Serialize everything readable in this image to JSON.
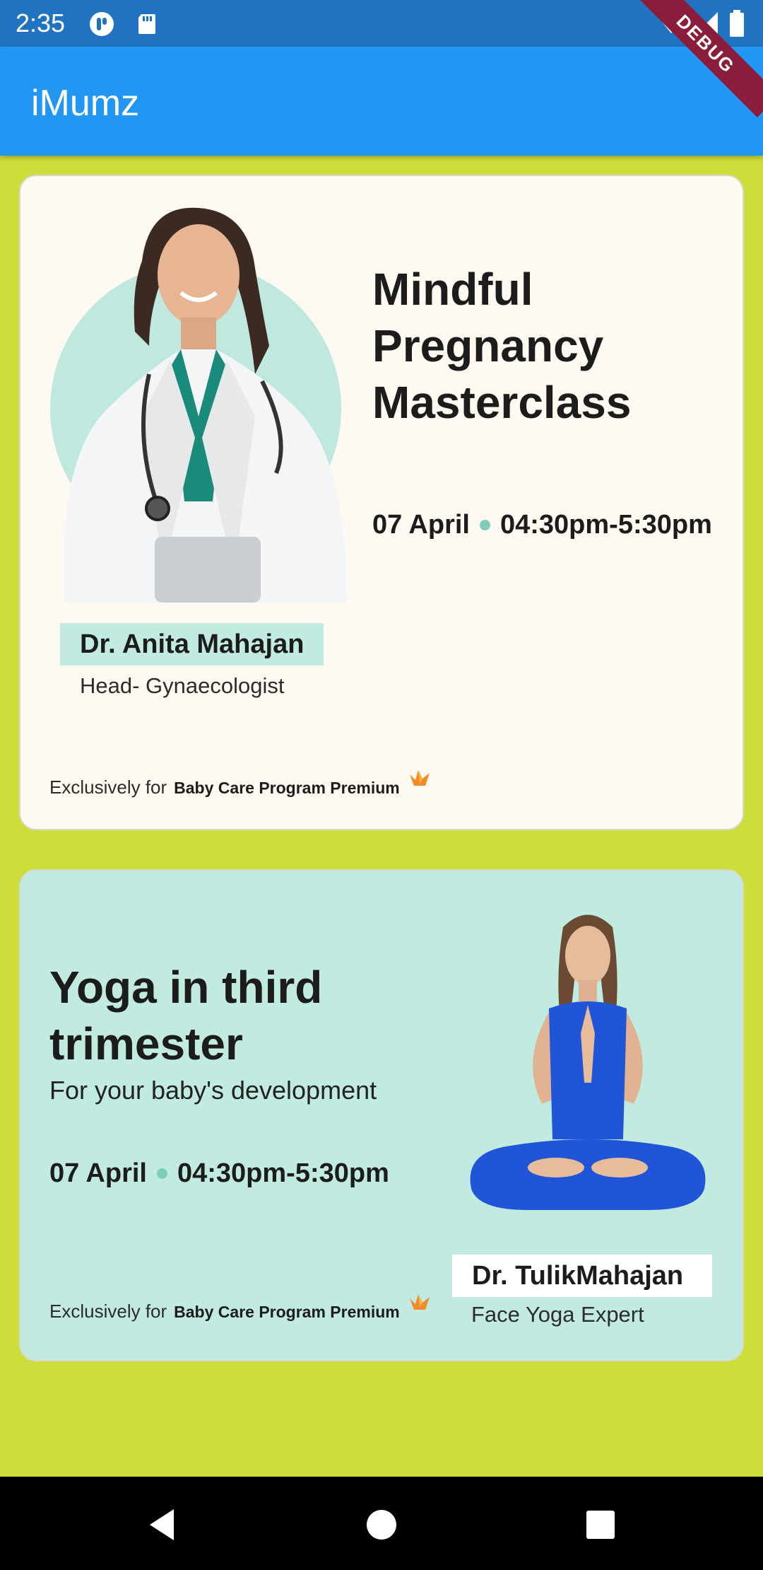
{
  "status_bar": {
    "time": "2:35",
    "icons_left": [
      "notification-app-icon",
      "sd-card-icon"
    ],
    "icons_right": [
      "wifi-icon",
      "signal-icon",
      "battery-icon"
    ]
  },
  "debug_banner": "DEBUG",
  "app_bar": {
    "title": "iMumz"
  },
  "cards": [
    {
      "title": "Mindful Pregnancy Masterclass",
      "date": "07 April",
      "time": "04:30pm-5:30pm",
      "speaker_name": "Dr. Anita Mahajan",
      "speaker_role": "Head- Gynaecologist",
      "exclusive_prefix": "Exclusively for",
      "exclusive_program": "Baby Care Program Premium",
      "background": "#fffaf1"
    },
    {
      "title": "Yoga in third trimester",
      "subtitle": "For your baby's development",
      "date": "07 April",
      "time": "04:30pm-5:30pm",
      "speaker_name": "Dr. TulikMahajan",
      "speaker_role": "Face Yoga Expert",
      "exclusive_prefix": "Exclusively for",
      "exclusive_program": "Baby Care Program Premium",
      "background": "#c1eae1"
    }
  ],
  "colors": {
    "status_bar": "#1f73c0",
    "app_bar": "#2196f3",
    "page_background": "#cddd3a",
    "accent_teal": "#7ccdb9",
    "premium_icon": "#f28c28"
  },
  "nav_bar": {
    "buttons": [
      "back-icon",
      "home-icon",
      "recents-icon"
    ]
  }
}
